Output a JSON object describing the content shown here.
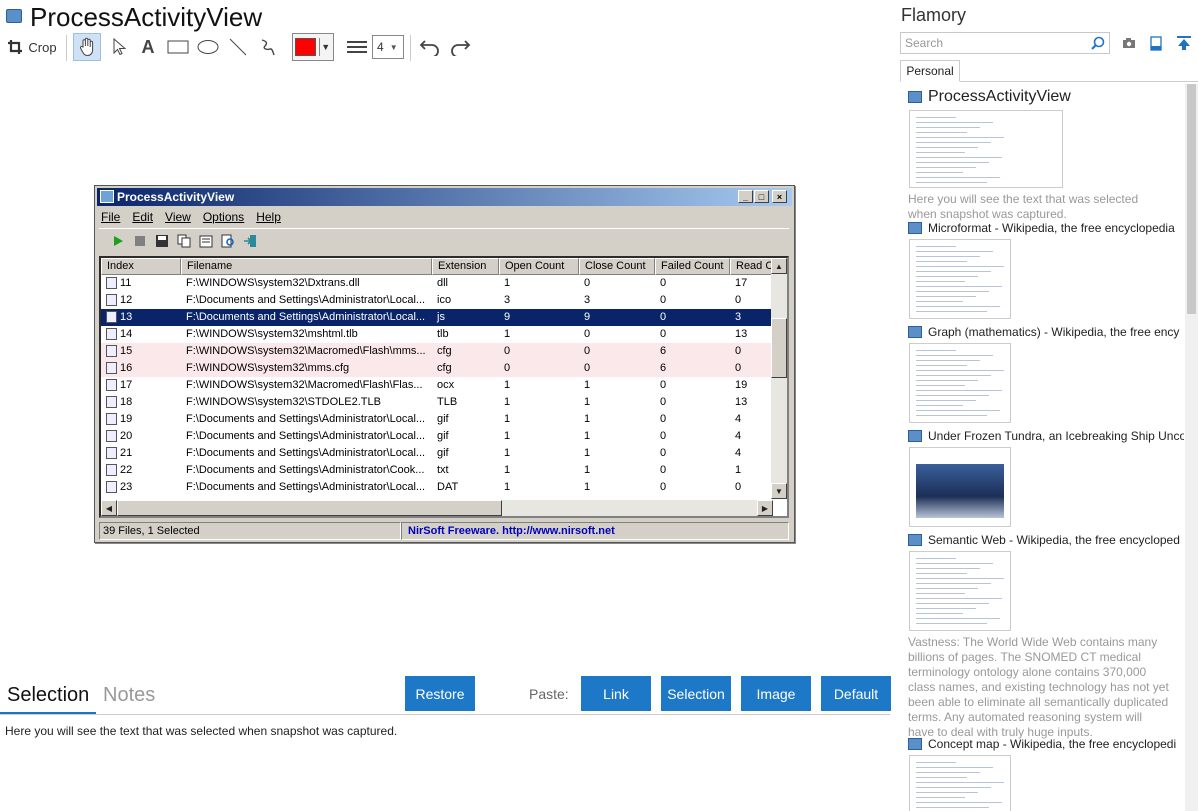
{
  "app": {
    "title": "ProcessActivityView",
    "toolbar": {
      "crop_label": "Crop",
      "line_width": "4",
      "color": "#ff0000"
    }
  },
  "snapshot": {
    "window_title": "ProcessActivityView",
    "menu": [
      "File",
      "Edit",
      "View",
      "Options",
      "Help"
    ],
    "columns": [
      "Index",
      "Filename",
      "Extension",
      "Open Count",
      "Close Count",
      "Failed Count",
      "Read Co"
    ],
    "rows": [
      {
        "index": "11",
        "filename": "F:\\WINDOWS\\system32\\Dxtrans.dll",
        "ext": "dll",
        "open": "1",
        "close": "0",
        "failed": "0",
        "read": "17",
        "style": ""
      },
      {
        "index": "12",
        "filename": "F:\\Documents and Settings\\Administrator\\Local...",
        "ext": "ico",
        "open": "3",
        "close": "3",
        "failed": "0",
        "read": "0",
        "style": ""
      },
      {
        "index": "13",
        "filename": "F:\\Documents and Settings\\Administrator\\Local...",
        "ext": "js",
        "open": "9",
        "close": "9",
        "failed": "0",
        "read": "3",
        "style": "sel"
      },
      {
        "index": "14",
        "filename": "F:\\WINDOWS\\system32\\mshtml.tlb",
        "ext": "tlb",
        "open": "1",
        "close": "0",
        "failed": "0",
        "read": "13",
        "style": ""
      },
      {
        "index": "15",
        "filename": "F:\\WINDOWS\\system32\\Macromed\\Flash\\mms...",
        "ext": "cfg",
        "open": "0",
        "close": "0",
        "failed": "6",
        "read": "0",
        "style": "pink"
      },
      {
        "index": "16",
        "filename": "F:\\WINDOWS\\system32\\mms.cfg",
        "ext": "cfg",
        "open": "0",
        "close": "0",
        "failed": "6",
        "read": "0",
        "style": "pink"
      },
      {
        "index": "17",
        "filename": "F:\\WINDOWS\\system32\\Macromed\\Flash\\Flas...",
        "ext": "ocx",
        "open": "1",
        "close": "1",
        "failed": "0",
        "read": "19",
        "style": ""
      },
      {
        "index": "18",
        "filename": "F:\\WINDOWS\\system32\\STDOLE2.TLB",
        "ext": "TLB",
        "open": "1",
        "close": "1",
        "failed": "0",
        "read": "13",
        "style": ""
      },
      {
        "index": "19",
        "filename": "F:\\Documents and Settings\\Administrator\\Local...",
        "ext": "gif",
        "open": "1",
        "close": "1",
        "failed": "0",
        "read": "4",
        "style": ""
      },
      {
        "index": "20",
        "filename": "F:\\Documents and Settings\\Administrator\\Local...",
        "ext": "gif",
        "open": "1",
        "close": "1",
        "failed": "0",
        "read": "4",
        "style": ""
      },
      {
        "index": "21",
        "filename": "F:\\Documents and Settings\\Administrator\\Local...",
        "ext": "gif",
        "open": "1",
        "close": "1",
        "failed": "0",
        "read": "4",
        "style": ""
      },
      {
        "index": "22",
        "filename": "F:\\Documents and Settings\\Administrator\\Cook...",
        "ext": "txt",
        "open": "1",
        "close": "1",
        "failed": "0",
        "read": "1",
        "style": ""
      },
      {
        "index": "23",
        "filename": "F:\\Documents and Settings\\Administrator\\Local...",
        "ext": "DAT",
        "open": "1",
        "close": "1",
        "failed": "0",
        "read": "0",
        "style": ""
      }
    ],
    "status_files": "39 Files, 1 Selected",
    "status_link": "NirSoft Freeware.  http://www.nirsoft.net"
  },
  "bottom": {
    "tab_selection": "Selection",
    "tab_notes": "Notes",
    "restore": "Restore",
    "paste_label": "Paste:",
    "link": "Link",
    "selection": "Selection",
    "image": "Image",
    "default": "Default",
    "selected_text": "Here you will see the text that was selected when snapshot was captured."
  },
  "sidebar": {
    "title": "Flamory",
    "search_placeholder": "Search",
    "tab": "Personal",
    "cards": [
      {
        "title": "ProcessActivityView",
        "desc": "Here you will see the text that was selected when snapshot was captured."
      },
      {
        "title": "Microformat - Wikipedia, the free encyclopedia",
        "desc": ""
      },
      {
        "title": "Graph (mathematics) - Wikipedia, the free ency",
        "desc": ""
      },
      {
        "title": "Under Frozen Tundra, an Icebreaking Ship Unco",
        "desc": ""
      },
      {
        "title": "Semantic Web - Wikipedia, the free encycloped",
        "desc": "Vastness: The World Wide Web contains many billions of pages. The SNOMED CT medical terminology ontology alone contains 370,000 class names, and existing technology has not yet been able to eliminate all semantically duplicated terms. Any automated reasoning system will have to deal with truly huge inputs."
      },
      {
        "title": "Concept map - Wikipedia, the free encyclopedi",
        "desc": ""
      }
    ]
  }
}
